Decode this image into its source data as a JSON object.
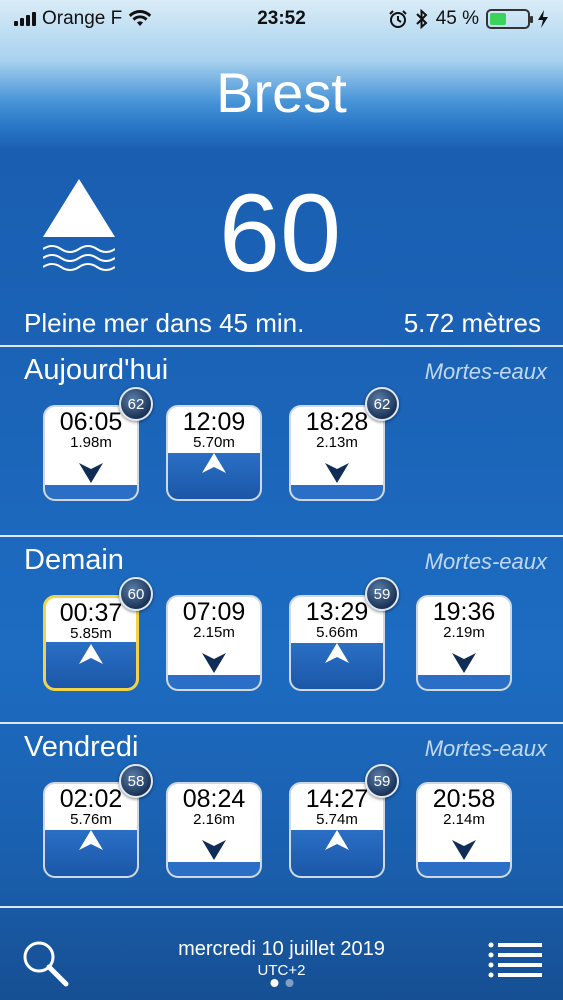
{
  "status_bar": {
    "carrier": "Orange F",
    "time": "23:52",
    "battery_percent": "45 %",
    "battery_level": 0.45
  },
  "location": {
    "city": "Brest"
  },
  "current": {
    "coefficient": "60",
    "next_tide_text": "Pleine mer dans 45 min.",
    "height_text": "5.72  mètres"
  },
  "days": [
    {
      "title": "Aujourd'hui",
      "note": "Mortes-eaux",
      "tides": [
        {
          "time": "06:05",
          "height": "1.98m",
          "type": "low",
          "coef": "62"
        },
        {
          "time": "12:09",
          "height": "5.70m",
          "type": "high"
        },
        {
          "time": "18:28",
          "height": "2.13m",
          "type": "low",
          "coef": "62"
        }
      ]
    },
    {
      "title": "Demain",
      "note": "Mortes-eaux",
      "tides": [
        {
          "time": "00:37",
          "height": "5.85m",
          "type": "high",
          "highlight": true,
          "coef": "60"
        },
        {
          "time": "07:09",
          "height": "2.15m",
          "type": "low"
        },
        {
          "time": "13:29",
          "height": "5.66m",
          "type": "high",
          "coef": "59"
        },
        {
          "time": "19:36",
          "height": "2.19m",
          "type": "low"
        }
      ]
    },
    {
      "title": "Vendredi",
      "note": "Mortes-eaux",
      "tides": [
        {
          "time": "02:02",
          "height": "5.76m",
          "type": "high",
          "coef": "58"
        },
        {
          "time": "08:24",
          "height": "2.16m",
          "type": "low"
        },
        {
          "time": "14:27",
          "height": "5.74m",
          "type": "high",
          "coef": "59"
        },
        {
          "time": "20:58",
          "height": "2.14m",
          "type": "low"
        }
      ]
    }
  ],
  "footer": {
    "date": "mercredi 10 juillet 2019",
    "timezone": "UTC+2",
    "pages": 2,
    "active_page": 0
  },
  "icons": {
    "search": "search-icon",
    "menu": "list-menu-icon",
    "tide_direction": "rising-tide-icon"
  },
  "colors": {
    "highlight_border": "#f0d34a",
    "water_blue": "#1b5fb0"
  }
}
